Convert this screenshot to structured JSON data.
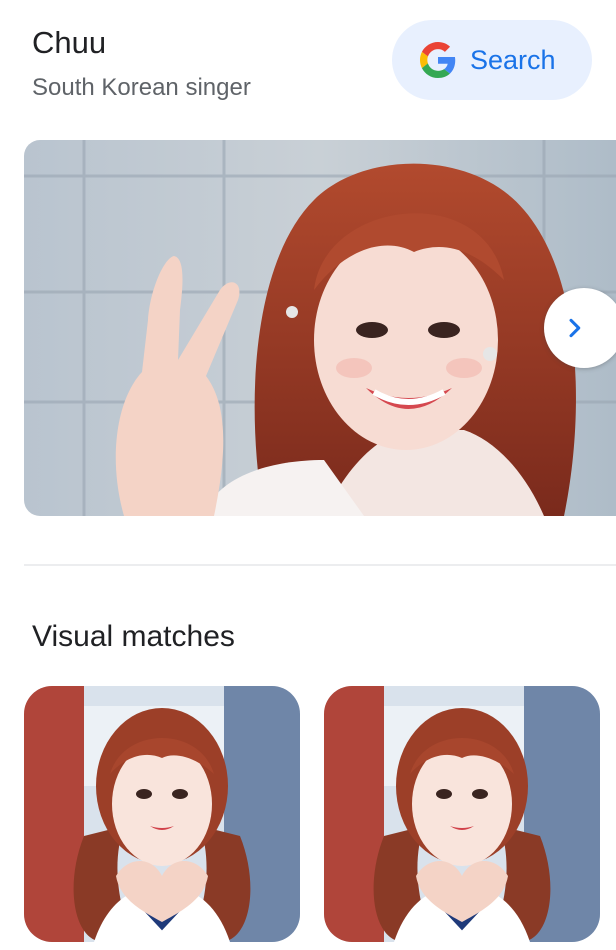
{
  "entity": {
    "name": "Chuu",
    "description": "South Korean singer"
  },
  "search_button": {
    "label": "Search",
    "icon": "google-g-icon"
  },
  "hero": {
    "image": "photo-of-chuu-peace-sign",
    "next_icon": "chevron-right-icon"
  },
  "visual_matches": {
    "title": "Visual matches",
    "items": [
      {
        "image": "photo-of-chuu-heart-hands"
      },
      {
        "image": "photo-of-chuu-heart-hands"
      }
    ]
  },
  "colors": {
    "accent": "#1a73e8",
    "search_bg": "#e8f0fe",
    "subtitle": "#5f6368",
    "title": "#202124"
  }
}
